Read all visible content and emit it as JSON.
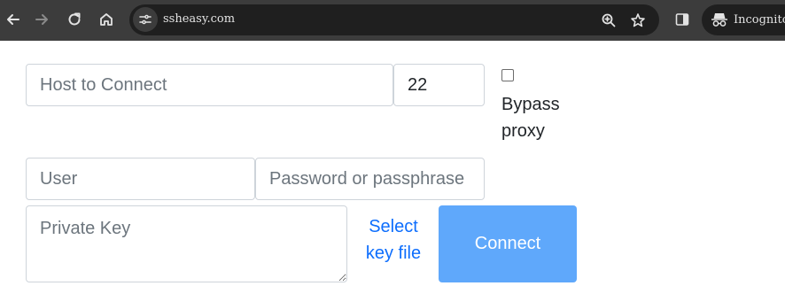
{
  "browser": {
    "url": "ssheasy.com",
    "profile_label": "Incognito",
    "icons": {
      "back": "back-arrow-icon",
      "forward": "forward-arrow-icon",
      "reload": "reload-icon",
      "home": "home-icon",
      "site_info": "tune-icon",
      "zoom": "zoom-icon",
      "bookmark": "star-icon",
      "side_panel": "side-panel-icon",
      "incognito": "incognito-icon"
    }
  },
  "form": {
    "host": {
      "placeholder": "Host to Connect",
      "value": ""
    },
    "port": {
      "value": "22"
    },
    "bypass_proxy": {
      "label": "Bypass proxy",
      "checked": false
    },
    "user": {
      "placeholder": "User",
      "value": ""
    },
    "password": {
      "placeholder": "Password or passphrase",
      "value": ""
    },
    "private_key": {
      "placeholder": "Private Key",
      "value": ""
    },
    "select_key_link": "Select key file",
    "connect_label": "Connect"
  },
  "colors": {
    "toolbar": "#3c3c3c",
    "omnibox": "#1f1f1f",
    "link": "#0d6efd",
    "connect_button": "#5fa8fb"
  }
}
